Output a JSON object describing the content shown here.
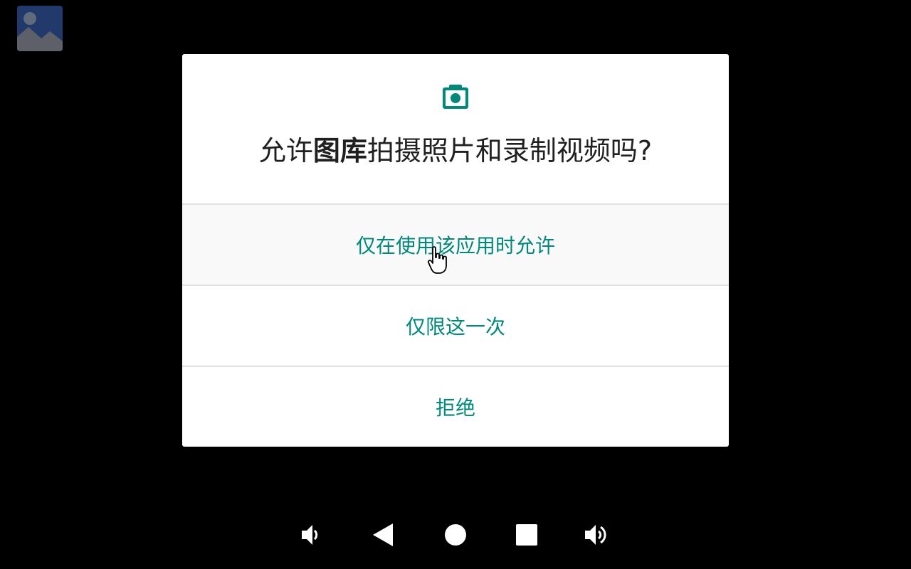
{
  "app": {
    "icon": "gallery-image-icon"
  },
  "dialog": {
    "icon": "camera-icon",
    "title_prefix": "允许",
    "title_app": "图库",
    "title_suffix": "拍摄照片和录制视频吗?",
    "options": [
      {
        "label": "仅在使用该应用时允许",
        "state": "hovered"
      },
      {
        "label": "仅限这一次"
      },
      {
        "label": "拒绝"
      }
    ],
    "accent_color": "#00897b"
  },
  "navbar": {
    "buttons": [
      "volume-down-icon",
      "back-icon",
      "home-icon",
      "recents-icon",
      "volume-up-icon"
    ]
  }
}
